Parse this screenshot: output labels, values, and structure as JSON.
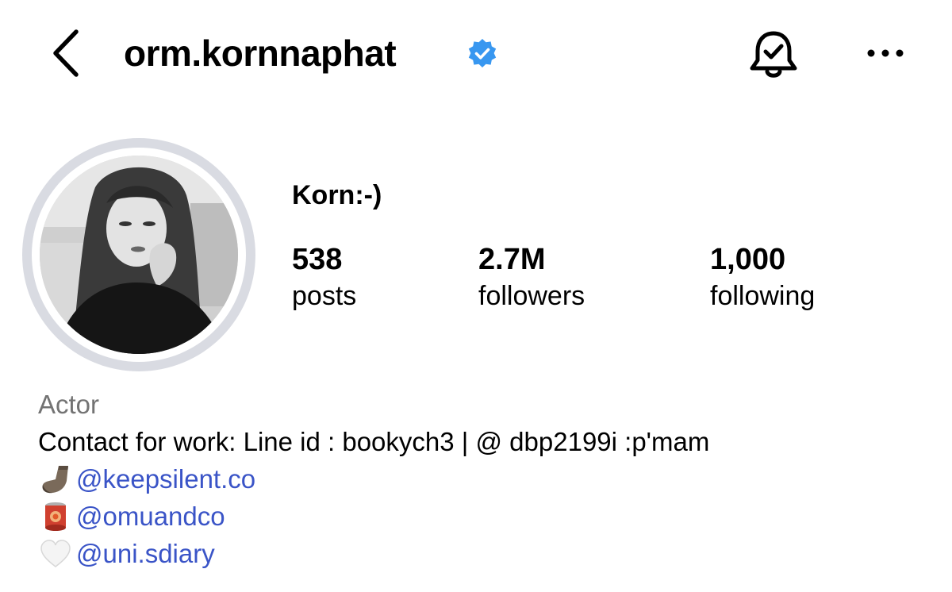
{
  "header": {
    "username": "orm.kornnaphat",
    "verified": true
  },
  "icons": {
    "back": "chevron-left-icon",
    "verified": "verified-badge-icon",
    "notifications": "bell-check-icon",
    "more": "more-horizontal-icon"
  },
  "profile": {
    "display_name": "Korn:-)",
    "stats": [
      {
        "value": "538",
        "label": "posts"
      },
      {
        "value": "2.7M",
        "label": "followers"
      },
      {
        "value": "1,000",
        "label": "following"
      }
    ]
  },
  "bio": {
    "category": "Actor",
    "contact": "Contact for work: Line id : bookych3 | @ dbp2199i :p'mam",
    "links": [
      {
        "emoji": "sock-emoji",
        "handle": "@keepsilent.co"
      },
      {
        "emoji": "can-emoji",
        "handle": "@omuandco"
      },
      {
        "emoji": "white-heart-emoji",
        "handle": "@uni.sdiary"
      }
    ]
  },
  "colors": {
    "text": "#000000",
    "category_text": "#737373",
    "link": "#3a54c7",
    "verified_badge": "#3897f0",
    "avatar_ring": "#d9dbe2"
  }
}
